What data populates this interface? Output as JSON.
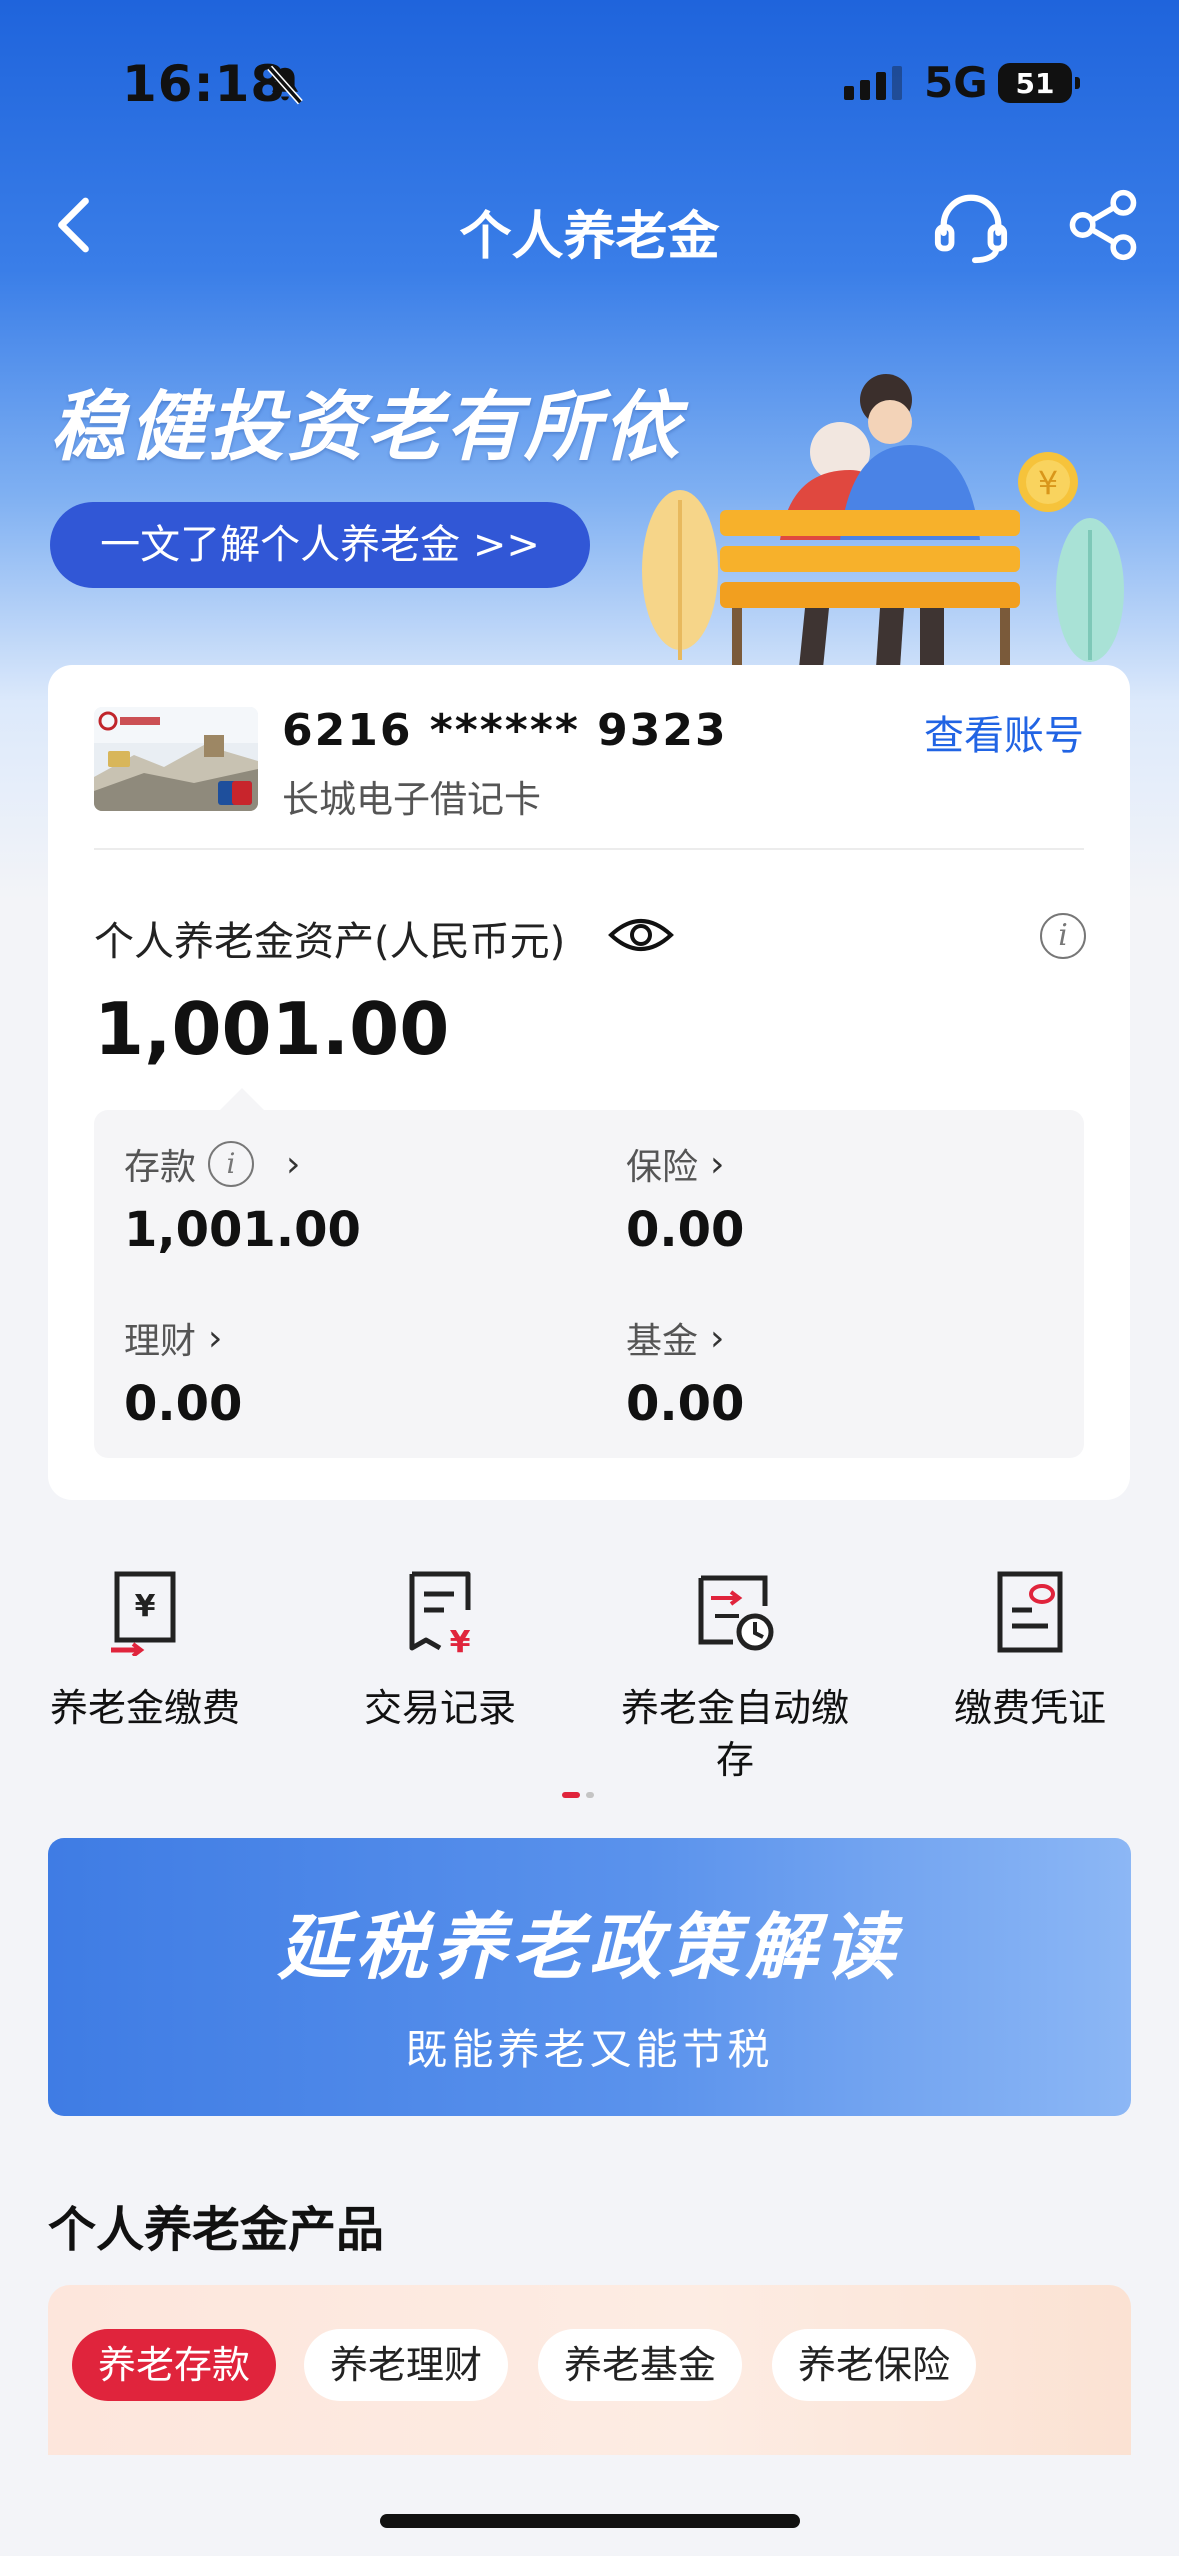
{
  "status_bar": {
    "time": "16:18",
    "network": "5G",
    "battery": "51"
  },
  "nav": {
    "title": "个人养老金"
  },
  "banner": {
    "headline": "稳健投资老有所依",
    "button_label": "一文了解个人养老金 >>"
  },
  "account": {
    "number": "6216 ****** 9323",
    "card_type": "长城电子借记卡",
    "view_label": "查看账号"
  },
  "assets": {
    "label": "个人养老金资产(人民币元)",
    "total": "1,001.00",
    "breakdown": [
      {
        "label": "存款",
        "value": "1,001.00"
      },
      {
        "label": "保险",
        "value": "0.00"
      },
      {
        "label": "理财",
        "value": "0.00"
      },
      {
        "label": "基金",
        "value": "0.00"
      }
    ]
  },
  "actions": [
    {
      "label": "养老金缴费",
      "icon": "receipt-yuan-icon"
    },
    {
      "label": "交易记录",
      "icon": "record-yuan-icon"
    },
    {
      "label": "养老金自动缴存",
      "icon": "auto-pay-clock-icon"
    },
    {
      "label": "缴费凭证",
      "icon": "voucher-icon"
    }
  ],
  "promo": {
    "title": "延税养老政策解读",
    "subtitle": "既能养老又能节税"
  },
  "products": {
    "section_title": "个人养老金产品",
    "tabs": [
      "养老存款",
      "养老理财",
      "养老基金",
      "养老保险"
    ],
    "active_tab": "养老存款"
  },
  "colors": {
    "brand_blue": "#2164e4",
    "accent_red": "#e0243c"
  }
}
